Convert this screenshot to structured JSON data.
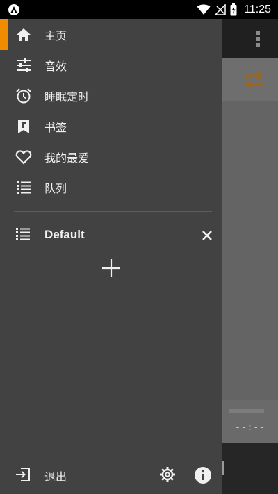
{
  "status_bar": {
    "time": "11:25",
    "icons": [
      "app-notification-icon",
      "wifi-icon",
      "signal-icon",
      "battery-charging-icon"
    ]
  },
  "drawer": {
    "accent_color": "#f08c00",
    "nav_items": [
      {
        "label": "主页",
        "icon": "home-icon",
        "active": true
      },
      {
        "label": "音效",
        "icon": "equalizer-icon",
        "active": false
      },
      {
        "label": "睡眠定时",
        "icon": "alarm-clock-icon",
        "active": false
      },
      {
        "label": "书签",
        "icon": "bookmark-icon",
        "active": false
      },
      {
        "label": "我的最爱",
        "icon": "heart-icon",
        "active": false
      },
      {
        "label": "队列",
        "icon": "queue-list-icon",
        "active": false
      }
    ],
    "queues": [
      {
        "label": "Default",
        "icon": "playlist-icon",
        "close_icon": "close-icon"
      }
    ],
    "add_queue_icon": "plus-icon",
    "footer": {
      "exit_label": "退出",
      "exit_icon": "exit-icon",
      "settings_icon": "gear-icon",
      "info_icon": "info-icon"
    }
  },
  "background_app": {
    "time_placeholder": "--:--",
    "repeat_icon_color": "#a0661a"
  }
}
